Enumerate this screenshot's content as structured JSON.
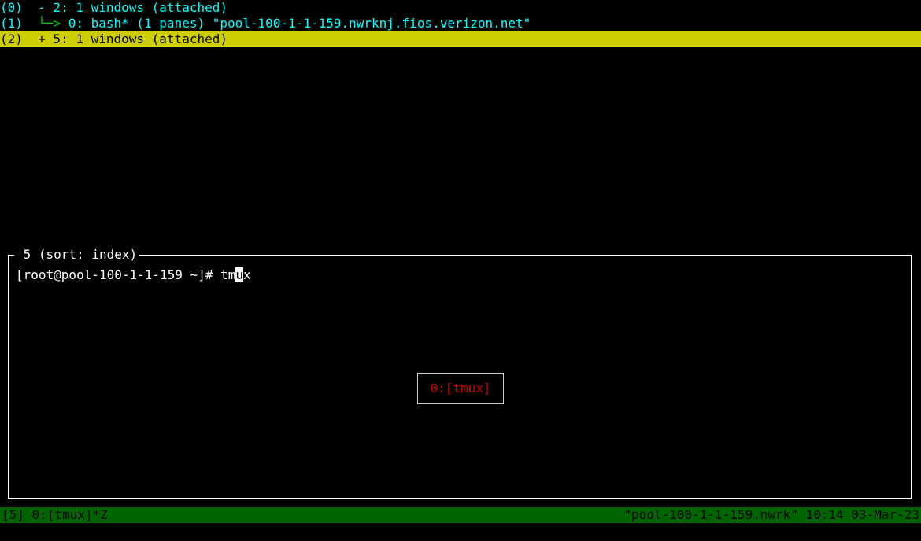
{
  "tree": {
    "line0": "(0)  - 2: 1 windows (attached)",
    "line1_prefix": "(1)  ",
    "line1_tree": "└─> ",
    "line1_body": "0: bash* (1 panes) \"pool-100-1-1-159.nwrknj.fios.verizon.net\"",
    "line2": "(2)  + 5: 1 windows (attached)"
  },
  "preview": {
    "title": " 5 (sort: index)",
    "prompt_prefix": "[root@pool-100-1-1-159 ~]# ",
    "typed_before": "tm",
    "typed_cursor": "u",
    "typed_after": "x"
  },
  "center_label": "0:[tmux]",
  "status": {
    "left": "[5] 0:[tmux]*Z",
    "right": "\"pool-100-1-1-159.nwrk\" 10:14 03-Mar-23"
  }
}
